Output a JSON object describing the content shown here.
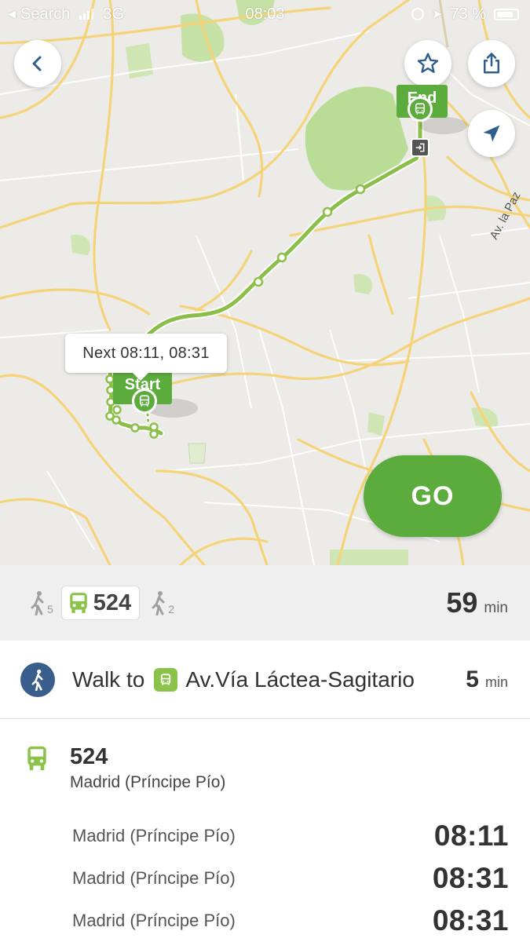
{
  "status_bar": {
    "carrier": "Search",
    "network": "3G",
    "time": "08:03",
    "battery": "73 %"
  },
  "map": {
    "next_departures": "Next 08:11, 08:31",
    "start_label": "Start",
    "end_label": "End",
    "street_label": "Av. la Paz",
    "go_label": "GO",
    "icons": {
      "back": "chevron-left-icon",
      "favorite": "star-icon",
      "share": "share-icon",
      "locate": "navigation-arrow-icon"
    }
  },
  "summary": {
    "walk_before_min": "5",
    "bus_line": "524",
    "walk_after_min": "2",
    "total_minutes": "59",
    "total_unit": "min"
  },
  "walk_step": {
    "prefix": "Walk to",
    "stop_name": "Av.Vía Láctea-Sagitario",
    "minutes": "5",
    "unit": "min"
  },
  "line": {
    "number": "524",
    "destination": "Madrid (Príncipe Pío)",
    "departures": [
      {
        "destination": "Madrid (Príncipe Pío)",
        "time": "08:11"
      },
      {
        "destination": "Madrid (Príncipe Pío)",
        "time": "08:31"
      },
      {
        "destination": "Madrid (Príncipe Pío)",
        "time": "08:31"
      }
    ]
  },
  "colors": {
    "brand_green": "#5bac3c",
    "route_green": "#8bbf4a",
    "walk_blue": "#3a5e8c",
    "road_yellow": "#f5d479",
    "park_green": "#b9dd96"
  }
}
